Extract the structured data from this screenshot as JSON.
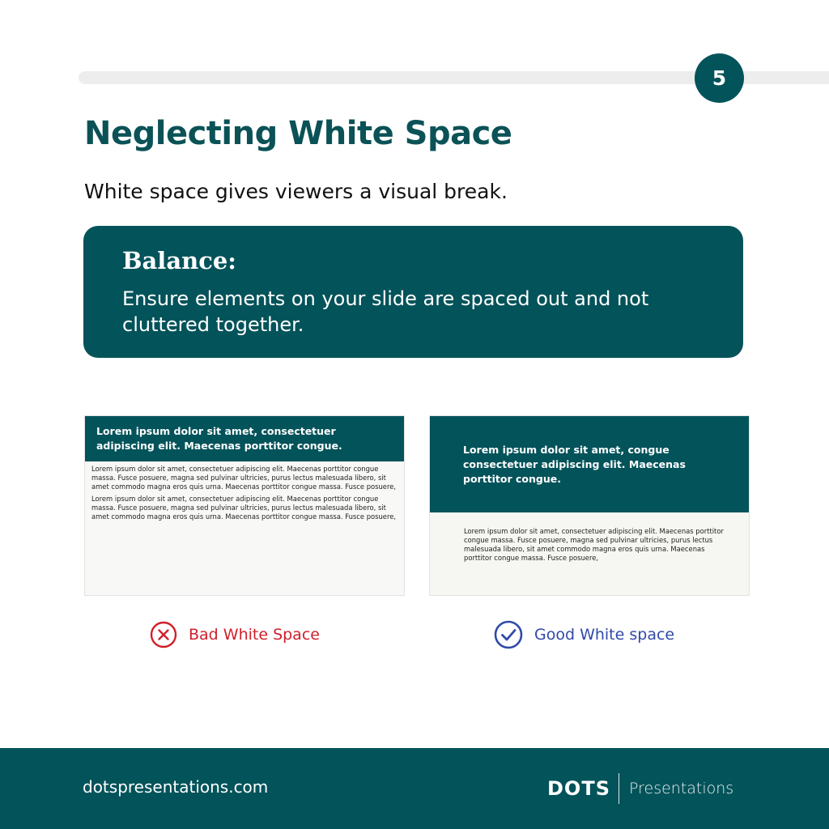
{
  "slide": {
    "page_number": "5",
    "title": "Neglecting White Space",
    "subtitle": "White space gives viewers a visual break."
  },
  "callout": {
    "heading": "Balance:",
    "body": "Ensure elements on your slide are spaced out and not cluttered together."
  },
  "examples": {
    "bad": {
      "header": "Lorem ipsum dolor sit amet, consectetuer adipiscing elit. Maecenas porttitor congue.",
      "paragraphs": [
        "Lorem ipsum dolor sit amet, consectetuer adipiscing elit. Maecenas porttitor congue massa. Fusce posuere, magna sed pulvinar ultricies, purus lectus malesuada libero, sit amet commodo magna eros quis urna. Maecenas porttitor congue massa. Fusce posuere,",
        "Lorem ipsum dolor sit amet, consectetuer adipiscing elit. Maecenas porttitor congue massa. Fusce posuere, magna sed pulvinar ultricies, purus lectus malesuada libero, sit amet commodo magna eros quis urna. Maecenas porttitor congue massa. Fusce posuere,"
      ],
      "label": "Bad White Space"
    },
    "good": {
      "header": "Lorem ipsum dolor sit amet, congue consectetuer adipiscing elit. Maecenas porttitor congue.",
      "paragraph": "Lorem ipsum dolor sit amet, consectetuer adipiscing elit. Maecenas porttitor congue massa. Fusce posuere, magna sed pulvinar ultricies, purus lectus malesuada libero, sit amet commodo magna eros quis urna. Maecenas porttitor congue massa. Fusce posuere,",
      "label": "Good White space"
    }
  },
  "footer": {
    "url": "dotspresentations.com",
    "logo_mark": "DOTS",
    "logo_word": "Presentations"
  },
  "icons": {
    "bad": "x-circle-icon",
    "good": "check-circle-icon"
  },
  "colors": {
    "brand": "#03535a",
    "bad": "#d0202a",
    "good": "#2f4aa8"
  }
}
